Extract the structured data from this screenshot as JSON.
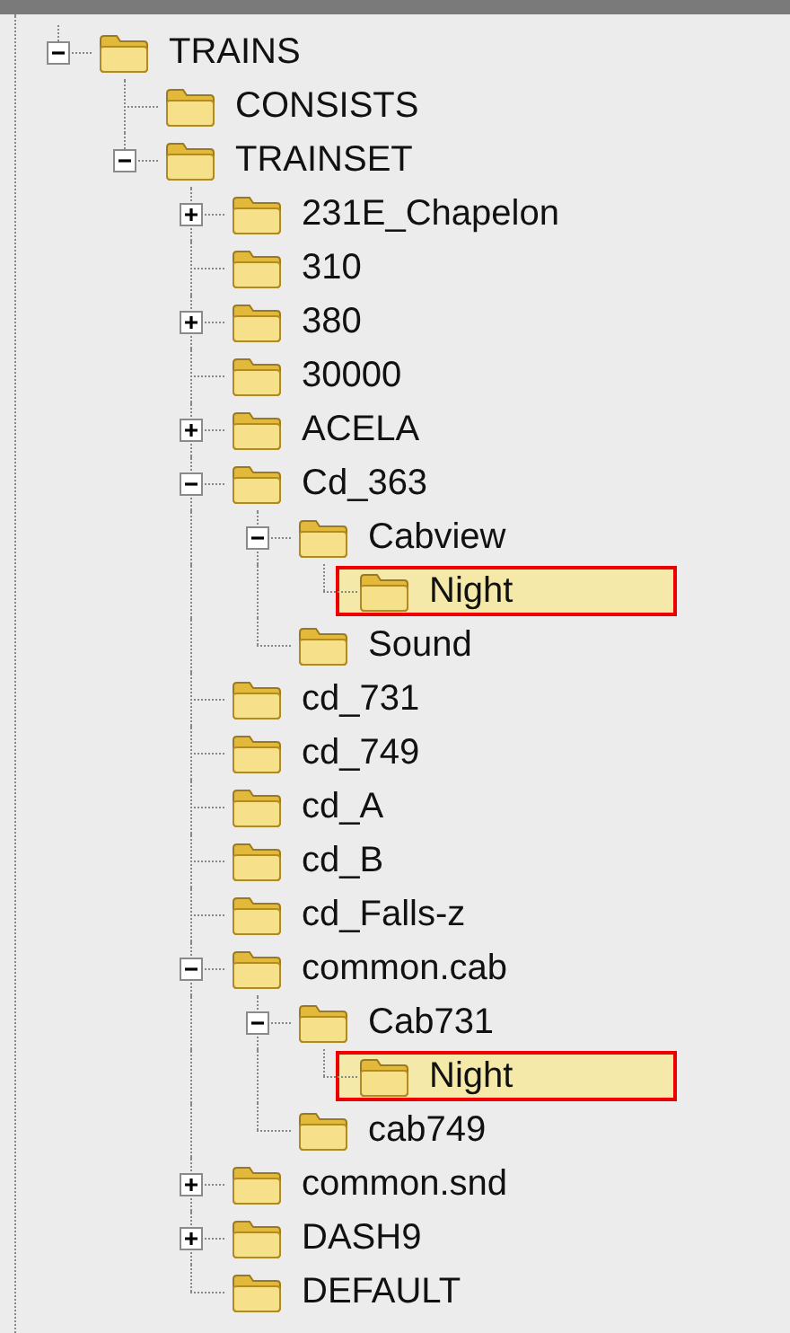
{
  "tree": [
    {
      "label": "TRAINS",
      "expanded": true,
      "selected": false,
      "children": [
        {
          "label": "CONSISTS",
          "selected": false
        },
        {
          "label": "TRAINSET",
          "expanded": true,
          "selected": false,
          "children": [
            {
              "label": "231E_Chapelon",
              "expanded": false,
              "selected": false
            },
            {
              "label": "310",
              "selected": false
            },
            {
              "label": "380",
              "expanded": false,
              "selected": false
            },
            {
              "label": "30000",
              "selected": false
            },
            {
              "label": "ACELA",
              "expanded": false,
              "selected": false
            },
            {
              "label": "Cd_363",
              "expanded": true,
              "selected": false,
              "children": [
                {
                  "label": "Cabview",
                  "expanded": true,
                  "selected": false,
                  "children": [
                    {
                      "label": "Night",
                      "selected": true
                    }
                  ]
                },
                {
                  "label": "Sound",
                  "selected": false
                }
              ]
            },
            {
              "label": "cd_731",
              "selected": false
            },
            {
              "label": "cd_749",
              "selected": false
            },
            {
              "label": "cd_A",
              "selected": false
            },
            {
              "label": "cd_B",
              "selected": false
            },
            {
              "label": "cd_Falls-z",
              "selected": false
            },
            {
              "label": "common.cab",
              "expanded": true,
              "selected": false,
              "children": [
                {
                  "label": "Cab731",
                  "expanded": true,
                  "selected": false,
                  "children": [
                    {
                      "label": "Night",
                      "selected": true
                    }
                  ]
                },
                {
                  "label": "cab749",
                  "selected": false
                }
              ]
            },
            {
              "label": "common.snd",
              "expanded": false,
              "selected": false
            },
            {
              "label": "DASH9",
              "expanded": false,
              "selected": false
            },
            {
              "label": "DEFAULT",
              "selected": false
            }
          ]
        }
      ]
    }
  ]
}
